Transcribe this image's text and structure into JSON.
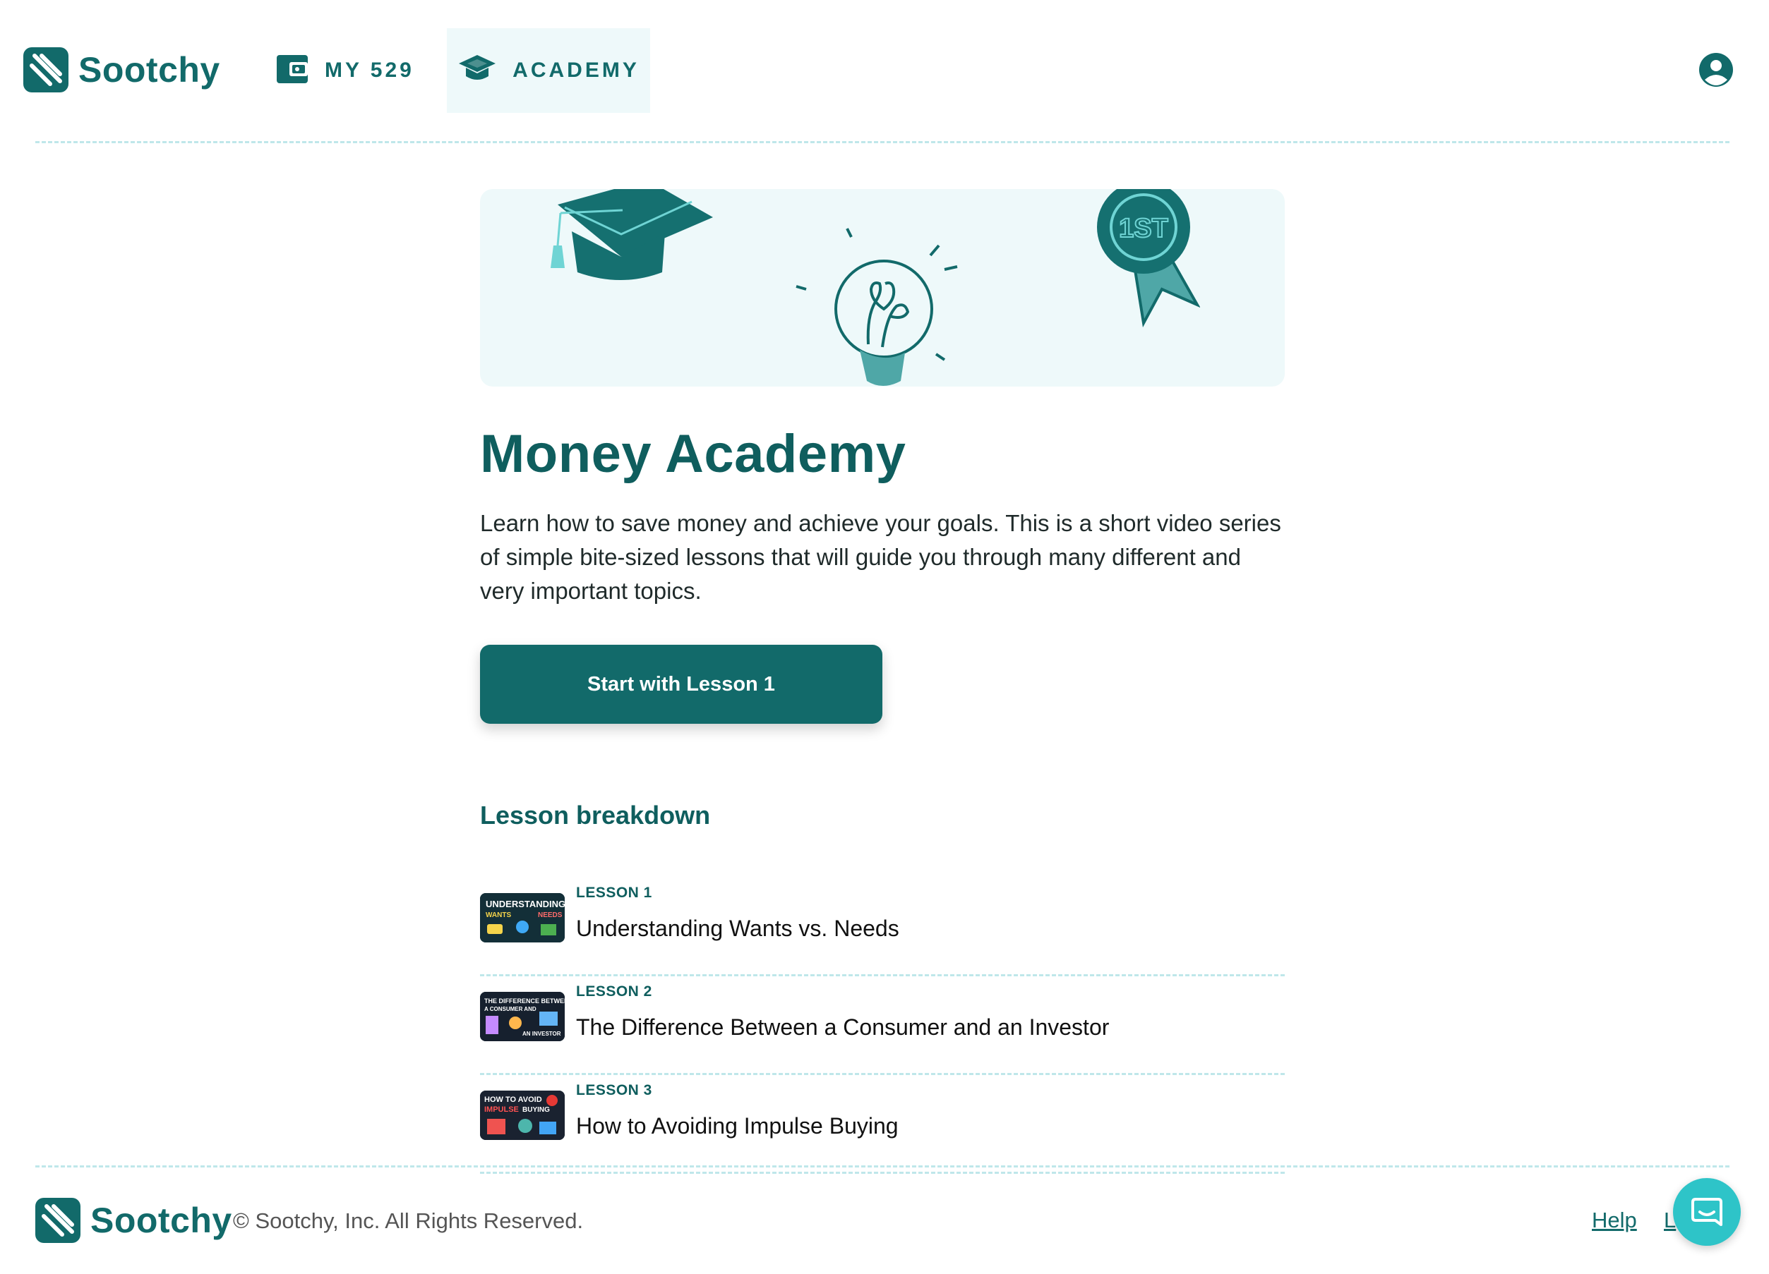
{
  "header": {
    "brand": "Sootchy",
    "nav": [
      {
        "label": "MY 529",
        "icon": "wallet-icon"
      },
      {
        "label": "ACADEMY",
        "icon": "graduation-cap-icon",
        "active": true
      }
    ],
    "profile_icon": "user-circle-icon"
  },
  "main": {
    "hero_icons": [
      "graduation-cap-icon",
      "lightbulb-icon",
      "first-place-ribbon-icon"
    ],
    "hero_badge_text": "1ST",
    "title": "Money Academy",
    "description": "Learn how to save money and achieve your goals. This is a short video series of simple bite-sized lessons that will guide you through many different and very important topics.",
    "cta_label": "Start with Lesson 1",
    "breakdown_title": "Lesson breakdown",
    "lessons": [
      {
        "number": "LESSON 1",
        "title": "Understanding Wants vs. Needs",
        "thumb_text": [
          "UNDERSTANDING",
          "WANTS",
          "NEEDS"
        ]
      },
      {
        "number": "LESSON 2",
        "title": "The Difference Between a Consumer and an Investor",
        "thumb_text": [
          "THE DIFFERENCE BETWEEN",
          "A CONSUMER AND",
          "AN INVESTOR"
        ]
      },
      {
        "number": "LESSON 3",
        "title": "How to Avoiding Impulse Buying",
        "thumb_text": [
          "HOW TO AVOID",
          "IMPULSE",
          "BUYING"
        ]
      }
    ]
  },
  "footer": {
    "brand": "Sootchy",
    "copyright": "© Sootchy, Inc. All Rights Reserved.",
    "help_link": "Help",
    "other_link": "L",
    "chat_icon": "chat-icon"
  },
  "colors": {
    "primary": "#126a6a",
    "title": "#0f5e5e",
    "hero_bg": "#eef9fa",
    "divider": "#bfe7ea",
    "chat": "#2ec4c8"
  }
}
